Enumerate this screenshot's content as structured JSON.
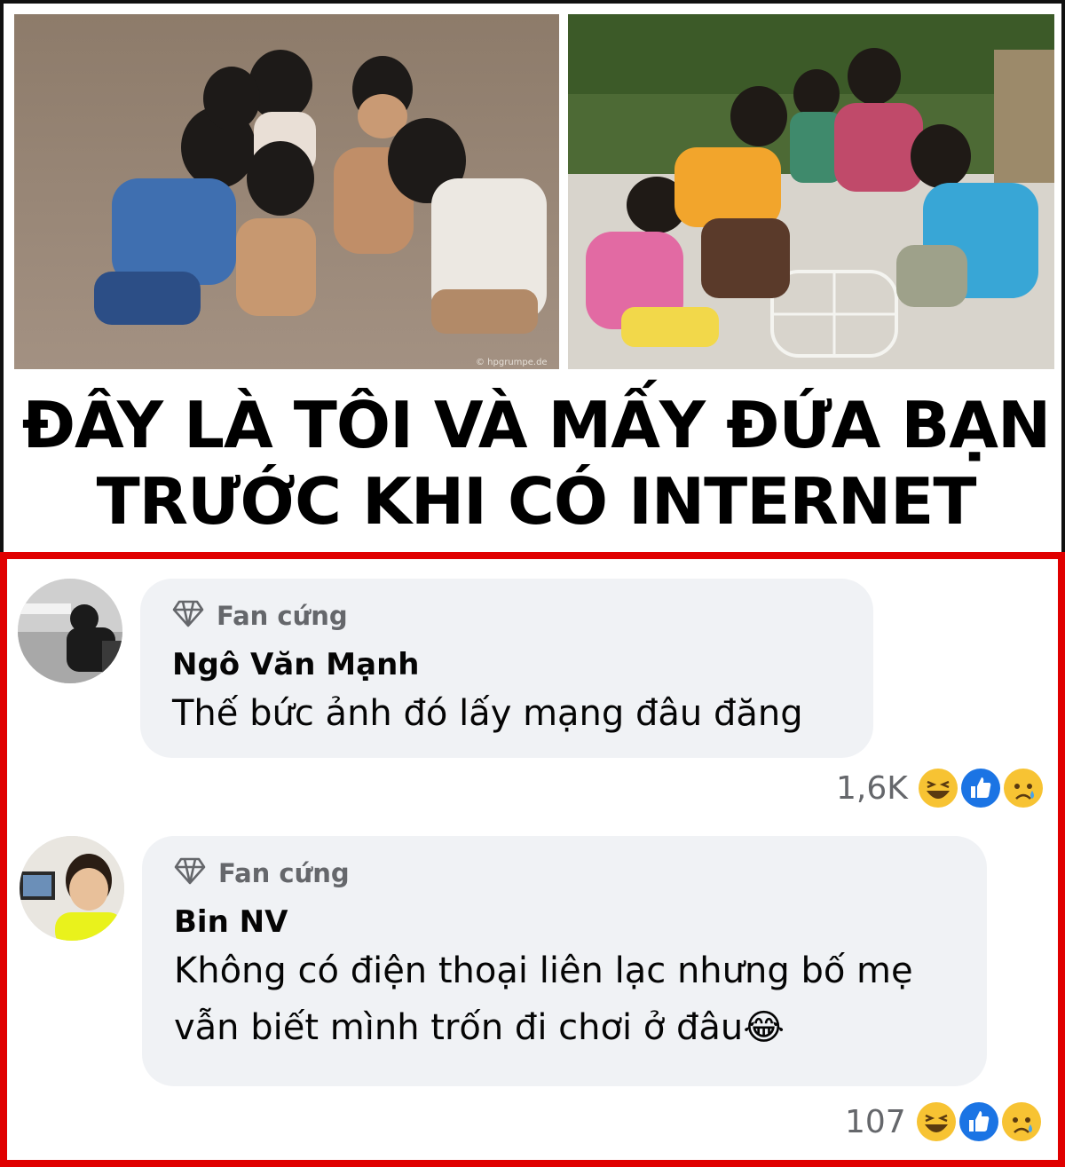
{
  "meme": {
    "caption_line1": "ĐÂY LÀ TÔI VÀ MẤY ĐỨA BẠN",
    "caption_line2": "TRƯỚC KHI CÓ INTERNET",
    "left_photo_credit": "© hpgrumpe.de"
  },
  "comments": [
    {
      "badge": "Fan cứng",
      "author": "Ngô Văn Mạnh",
      "text_lines": [
        "Thế bức ảnh đó lấy mạng đâu đăng"
      ],
      "reaction_count": "1,6K",
      "reactions": [
        "haha-icon",
        "like-icon",
        "sad-icon"
      ]
    },
    {
      "badge": "Fan cứng",
      "author": "Bin NV",
      "text_lines": [
        "Không có điện thoại liên lạc nhưng bố mẹ",
        "vẫn biết mình trốn đi chơi ở đâu😂"
      ],
      "reaction_count": "107",
      "reactions": [
        "haha-icon",
        "like-icon",
        "sad-icon"
      ]
    }
  ],
  "colors": {
    "highlight_border": "#e00000",
    "bubble_bg": "#f0f2f5",
    "meta_text": "#65676b"
  }
}
